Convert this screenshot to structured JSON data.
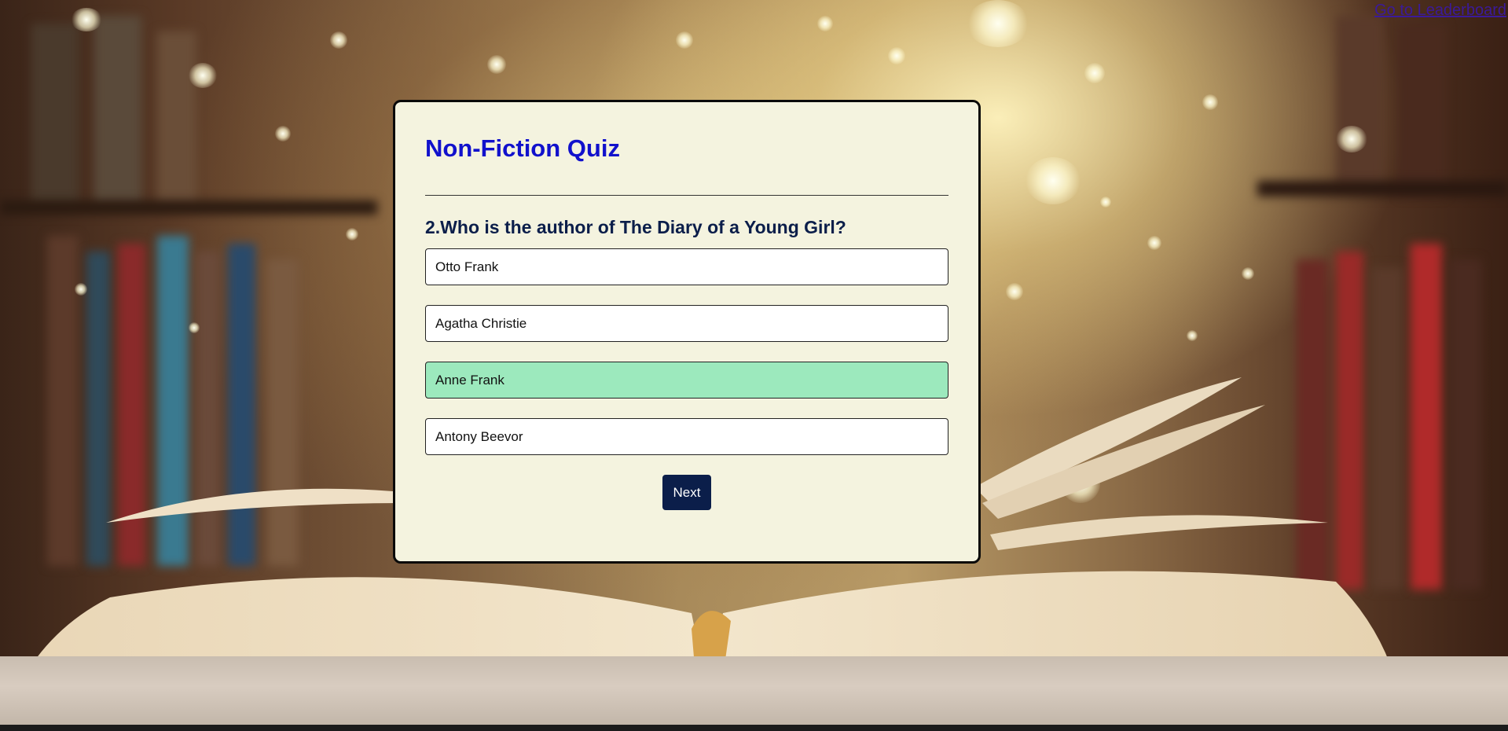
{
  "header": {
    "leaderboard_link": "Go to Leaderboard"
  },
  "quiz": {
    "title": "Non-Fiction Quiz",
    "question": "2.Who is the author of The Diary of a Young Girl?",
    "answers": [
      {
        "label": "Otto Frank",
        "state": "default"
      },
      {
        "label": "Agatha Christie",
        "state": "default"
      },
      {
        "label": "Anne Frank",
        "state": "correct"
      },
      {
        "label": "Antony Beevor",
        "state": "default"
      }
    ],
    "next_label": "Next"
  },
  "colors": {
    "title": "#1111cc",
    "question": "#0b1e4a",
    "card_background": "#f4f3df",
    "correct_answer": "#9ce9bd",
    "next_button": "#0b1e4a",
    "link": "#3b1a9a"
  }
}
